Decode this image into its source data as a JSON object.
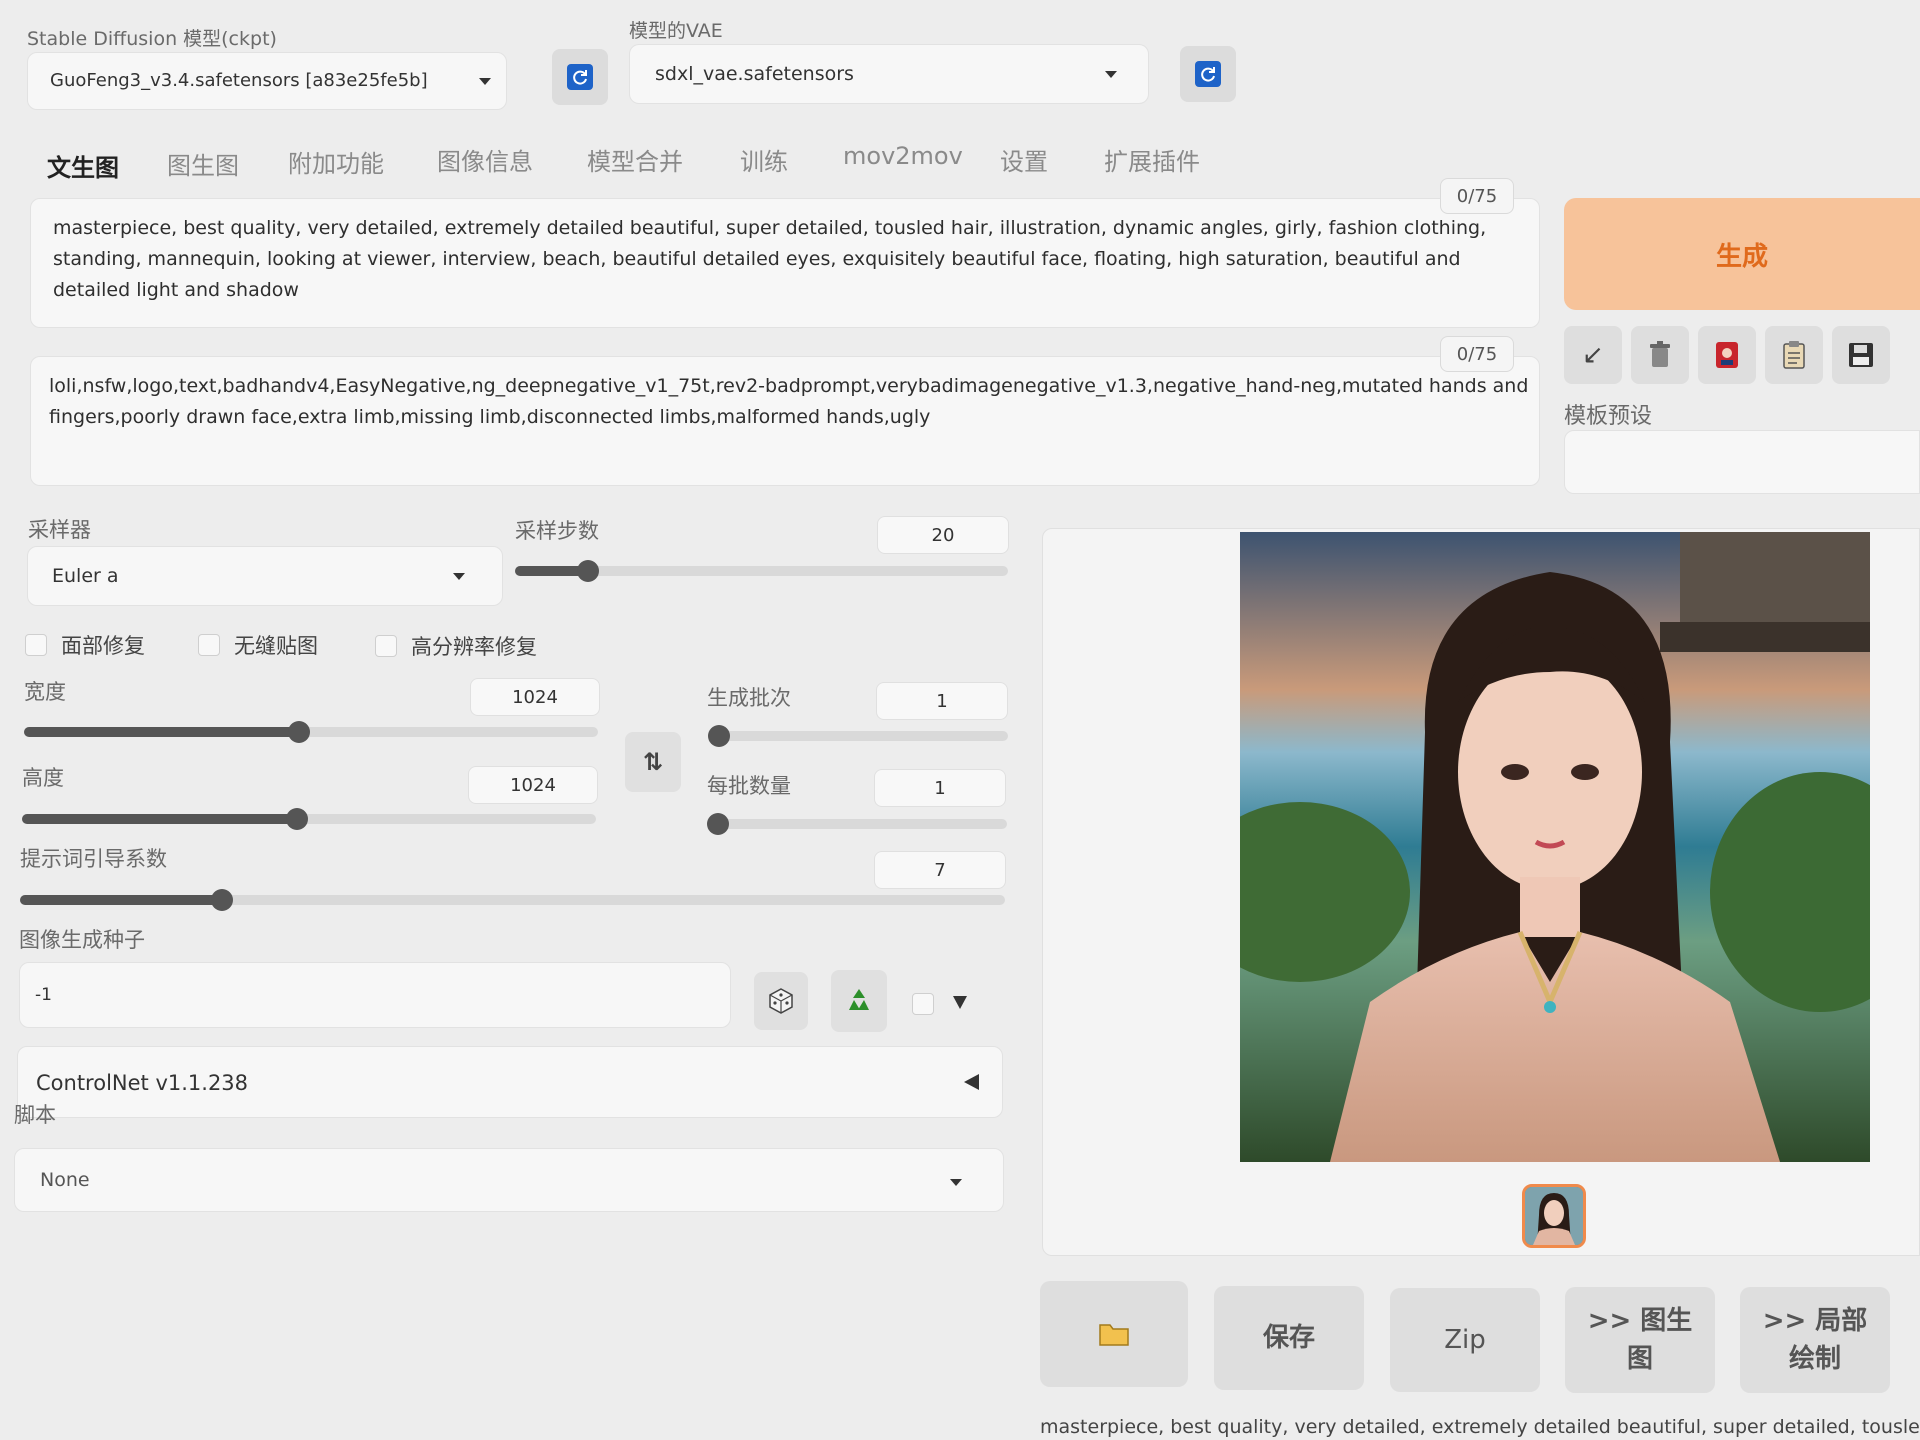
{
  "model": {
    "label": "Stable Diffusion 模型(ckpt)",
    "value": "GuoFeng3_v3.4.safetensors [a83e25fe5b]"
  },
  "vae": {
    "label": "模型的VAE",
    "value": "sdxl_vae.safetensors"
  },
  "tabs": [
    "文生图",
    "图生图",
    "附加功能",
    "图像信息",
    "模型合并",
    "训练",
    "mov2mov",
    "设置",
    "扩展插件"
  ],
  "prompt": {
    "counter": "0/75",
    "text": "masterpiece, best quality, very detailed, extremely detailed beautiful, super detailed, tousled hair, illustration, dynamic angles, girly, fashion clothing, standing, mannequin, looking at viewer, interview, beach, beautiful detailed eyes, exquisitely beautiful face, floating, high saturation, beautiful and detailed light and shadow"
  },
  "negative_prompt": {
    "counter": "0/75",
    "text": "loli,nsfw,logo,text,badhandv4,EasyNegative,ng_deepnegative_v1_75t,rev2-badprompt,verybadimagenegative_v1.3,negative_hand-neg,mutated hands and fingers,poorly drawn face,extra limb,missing limb,disconnected limbs,malformed hands,ugly"
  },
  "generate_label": "生成",
  "style_preset_label": "模板预设",
  "sampler": {
    "label": "采样器",
    "value": "Euler a"
  },
  "steps": {
    "label": "采样步数",
    "value": "20",
    "fraction": 0.15
  },
  "checkboxes": [
    {
      "label": "面部修复",
      "checked": false
    },
    {
      "label": "无缝贴图",
      "checked": false
    },
    {
      "label": "高分辨率修复",
      "checked": false
    }
  ],
  "width": {
    "label": "宽度",
    "value": "1024",
    "fraction": 0.48
  },
  "height": {
    "label": "高度",
    "value": "1024",
    "fraction": 0.48
  },
  "batch_count": {
    "label": "生成批次",
    "value": "1",
    "fraction": 0.0
  },
  "batch_size": {
    "label": "每批数量",
    "value": "1",
    "fraction": 0.0
  },
  "cfg": {
    "label": "提示词引导系数",
    "value": "7",
    "fraction": 0.2
  },
  "seed": {
    "label": "图像生成种子",
    "value": "-1"
  },
  "controlnet": {
    "label": "ControlNet v1.1.238"
  },
  "script": {
    "label": "脚本",
    "value": "None"
  },
  "output_buttons": {
    "save": "保存",
    "zip": "Zip",
    "img2img": ">> 图生图",
    "inpaint": ">> 局部绘制"
  },
  "output_caption": "masterpiece, best quality, very detailed, extremely detailed beautiful, super detailed, tousled",
  "colors": {
    "generate_bg": "#f7c39a",
    "generate_text": "#e06a1c",
    "refresh_blue": "#1e63c8",
    "thumbnail_border": "#f08a4b"
  }
}
